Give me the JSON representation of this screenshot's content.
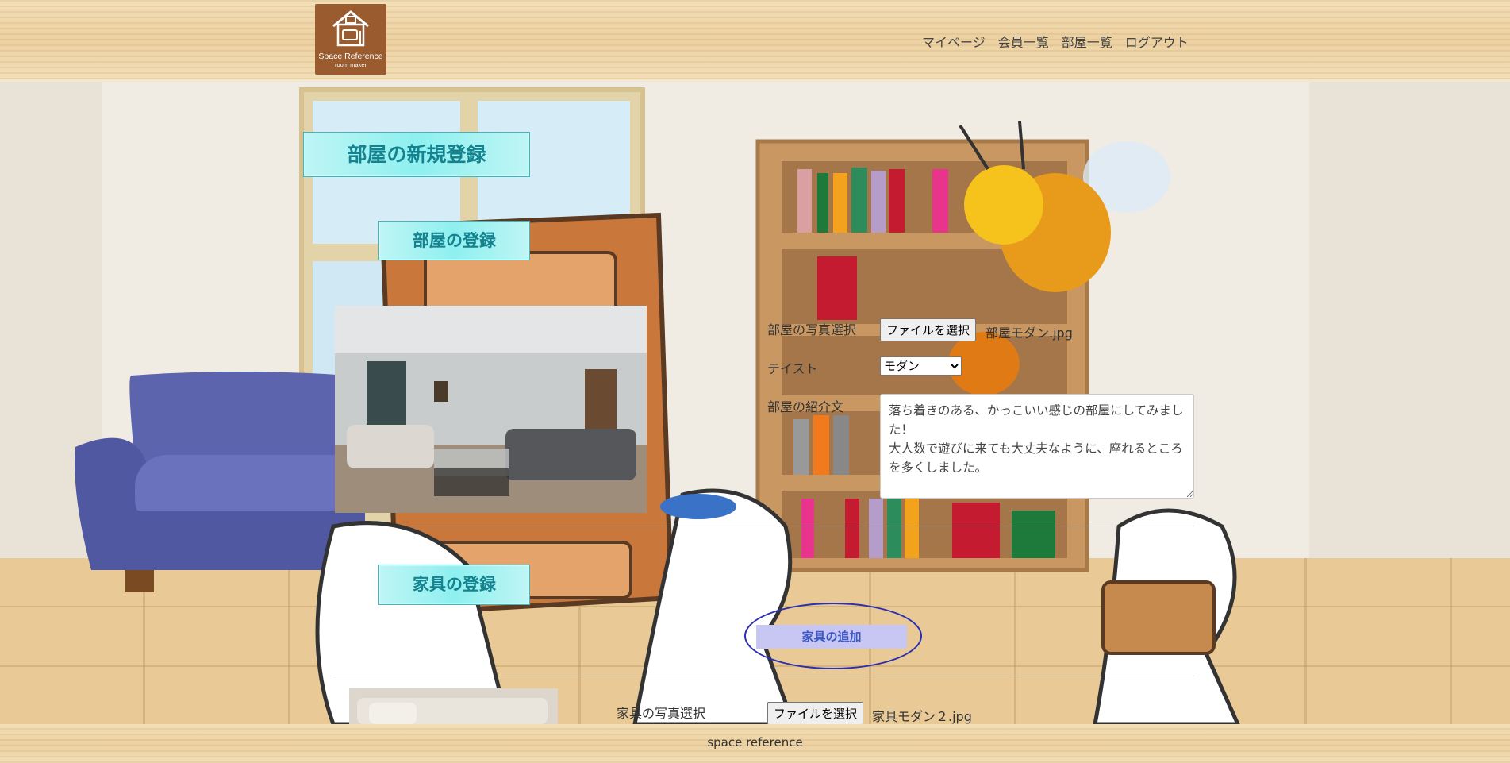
{
  "header": {
    "logo": {
      "line1": "Space Reference",
      "line2": "room maker"
    },
    "nav": [
      {
        "label": "マイページ"
      },
      {
        "label": "会員一覧"
      },
      {
        "label": "部屋一覧"
      },
      {
        "label": "ログアウト"
      }
    ]
  },
  "main": {
    "page_title": "部屋の新規登録",
    "room_section": {
      "title": "部屋の登録",
      "photo_label": "部屋の写真選択",
      "file_button": "ファイルを選択",
      "file_name": "部屋モダン.jpg",
      "taste_label": "テイスト",
      "taste_selected": "モダン",
      "intro_label": "部屋の紹介文",
      "intro_text": "落ち着きのある、かっこいい感じの部屋にしてみました！\n大人数で遊びに来ても大丈夫なように、座れるところを多くしました。"
    },
    "furniture_section": {
      "title": "家具の登録",
      "add_button": "家具の追加",
      "photo_label": "家具の写真選択",
      "file_button": "ファイルを選択",
      "file_name": "家具モダン２.jpg"
    }
  },
  "footer": {
    "text": "space reference"
  },
  "colors": {
    "title_text": "#14828f",
    "title_bg": "#8ef0ef",
    "logo_bg": "#9a5b2e",
    "add_button_bg": "#c8c6f2",
    "add_button_ring": "#2c2fb0"
  }
}
